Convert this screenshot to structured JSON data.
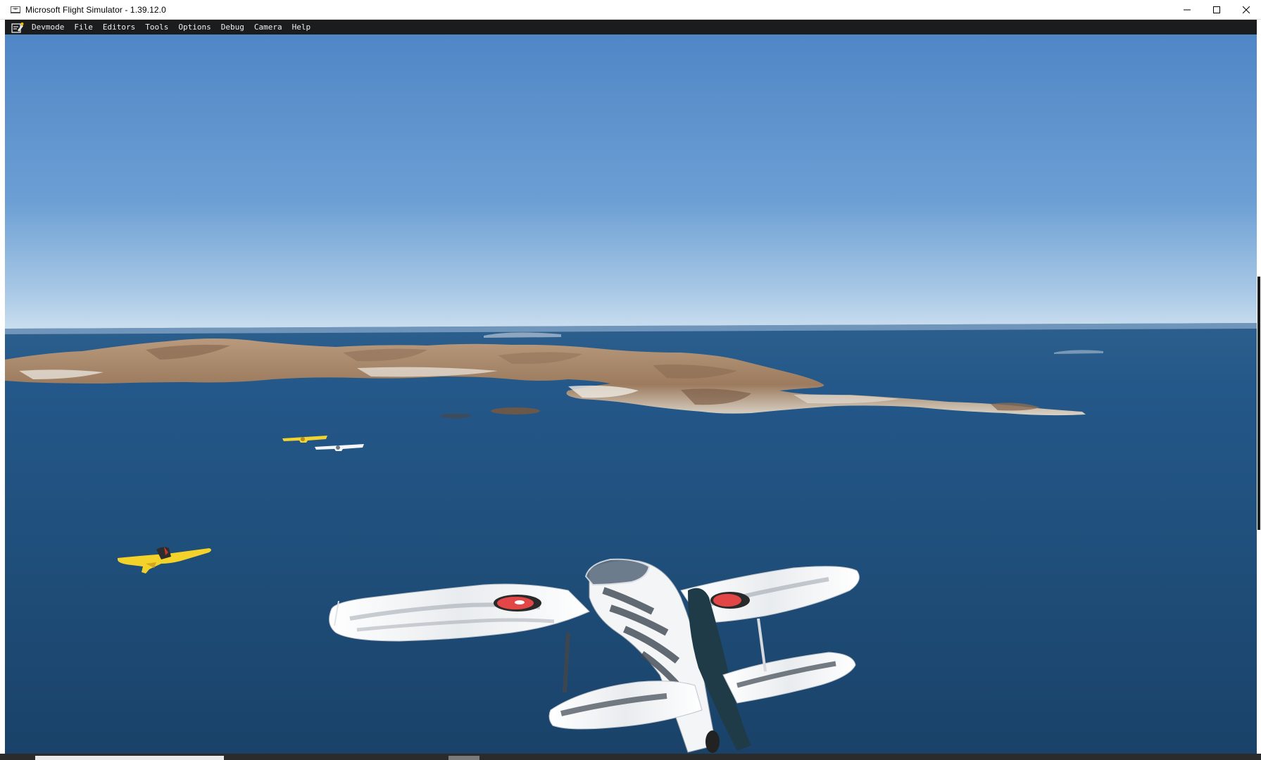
{
  "window": {
    "title": "Microsoft Flight Simulator - 1.39.12.0",
    "icon": "app-icon",
    "controls": {
      "minimize_icon": "minimize-icon",
      "maximize_icon": "maximize-icon",
      "close_icon": "close-icon"
    }
  },
  "menubar": {
    "icon": "devmode-icon",
    "items": [
      {
        "label": "Devmode"
      },
      {
        "label": "File"
      },
      {
        "label": "Editors"
      },
      {
        "label": "Tools"
      },
      {
        "label": "Options"
      },
      {
        "label": "Debug"
      },
      {
        "label": "Camera"
      },
      {
        "label": "Help"
      }
    ]
  },
  "colors": {
    "sky_top": "#4f86c6",
    "sky_horizon": "#c7dcee",
    "sea": "#1f4f7a",
    "menubar_bg": "#1b1c1e"
  }
}
